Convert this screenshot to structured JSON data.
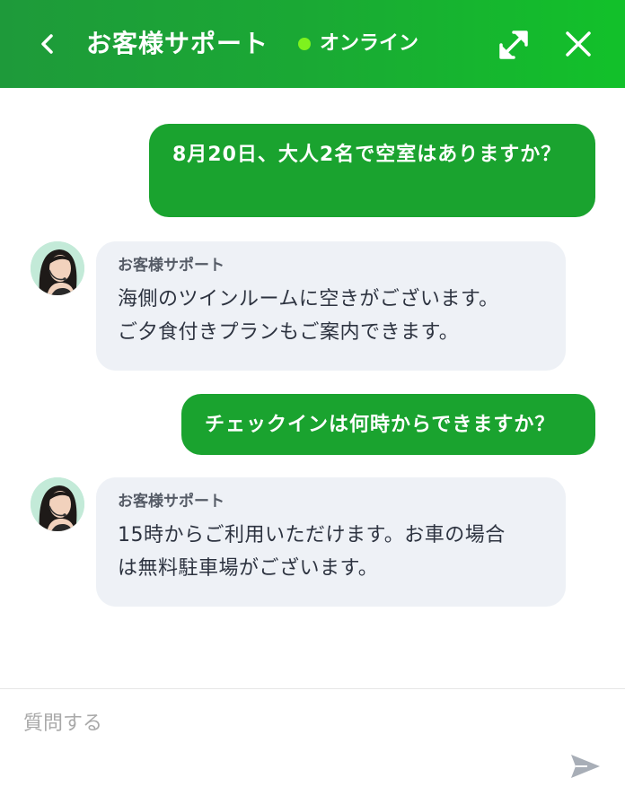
{
  "header": {
    "back_icon": "chevron-left-icon",
    "title": "お客様サポート",
    "status": "オンライン",
    "status_color": "#7ef21e",
    "expand_icon": "expand-icon",
    "close_icon": "close-icon",
    "accent_color": "#1aa32f"
  },
  "messages": [
    {
      "role": "user",
      "text": "8月20日、大人2名で空室はありますか？"
    },
    {
      "role": "agent",
      "name": "お客様サポート",
      "lines": [
        "海側のツインルームに空きがございます。",
        "ご夕食付きプランもご案内できます。"
      ]
    },
    {
      "role": "user",
      "text": "チェックインは何時からできますか？"
    },
    {
      "role": "agent",
      "name": "お客様サポート",
      "lines": [
        "15時からご利用いただけます。お車の場合",
        "は無料駐車場がございます。"
      ]
    }
  ],
  "composer": {
    "placeholder": "質問する",
    "send_icon": "send-icon"
  }
}
